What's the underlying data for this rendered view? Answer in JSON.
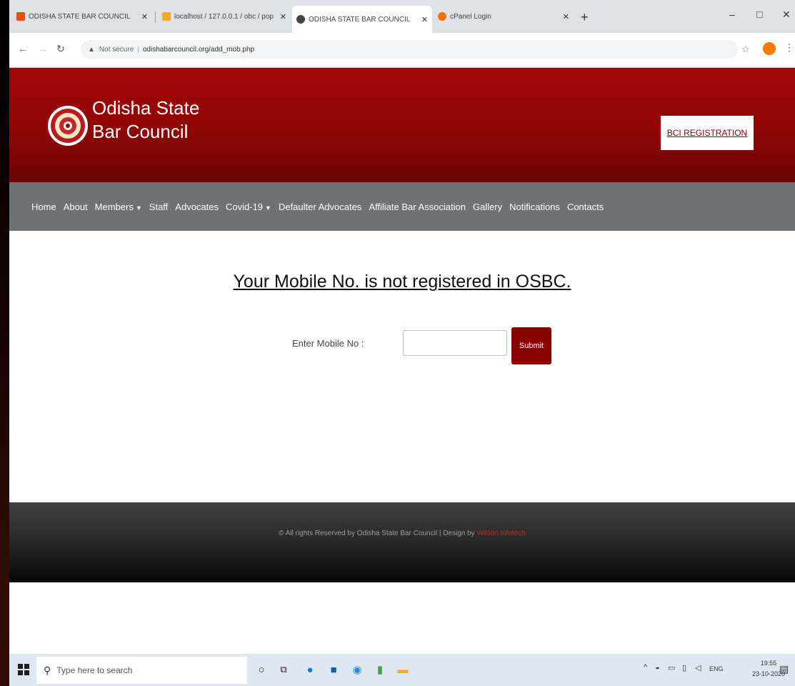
{
  "browser": {
    "tabs": [
      {
        "label": "ODISHA STATE BAR COUNCIL",
        "active": false
      },
      {
        "label": "localhost / 127.0.0.1 / obc / pop",
        "active": false
      },
      {
        "label": "ODISHA STATE BAR COUNCIL",
        "active": true
      },
      {
        "label": "cPanel Login",
        "active": false
      }
    ],
    "new_tab": "+",
    "controls": {
      "minimize": "–",
      "maximize": "□",
      "close": "✕"
    },
    "security_text": "Not secure",
    "url": "odishabarcouncil.org/add_mob.php"
  },
  "header": {
    "brand_line1": "Odisha State",
    "brand_line2": "Bar Council",
    "bci_button": "BCI REGISTRATION"
  },
  "nav": {
    "items": [
      {
        "label": "Home"
      },
      {
        "label": "About"
      },
      {
        "label": "Members",
        "dropdown": true
      },
      {
        "label": "Staff"
      },
      {
        "label": "Advocates"
      },
      {
        "label": "Covid-19",
        "dropdown": true
      },
      {
        "label": "Defaulter Advocates"
      },
      {
        "label": "Affiliate Bar Association"
      },
      {
        "label": "Gallery"
      },
      {
        "label": "Notifications"
      },
      {
        "label": "Contacts"
      }
    ]
  },
  "main": {
    "notice": "Your Mobile No. is not registered in OSBC.",
    "mobile_label": "Enter Mobile No :",
    "mobile_value": "",
    "submit_label": "Submit"
  },
  "footer": {
    "text": "© All rights Reserved by Odisha State Bar Council | Design by",
    "link": "Wilson Infotech"
  },
  "taskbar": {
    "search_placeholder": "Type here to search",
    "lang": "ENG",
    "time": "19:55",
    "date": "23-10-2020"
  },
  "colors": {
    "header_red": "#a30808",
    "nav_gray": "#6b7378",
    "button_red": "#8b0000"
  }
}
